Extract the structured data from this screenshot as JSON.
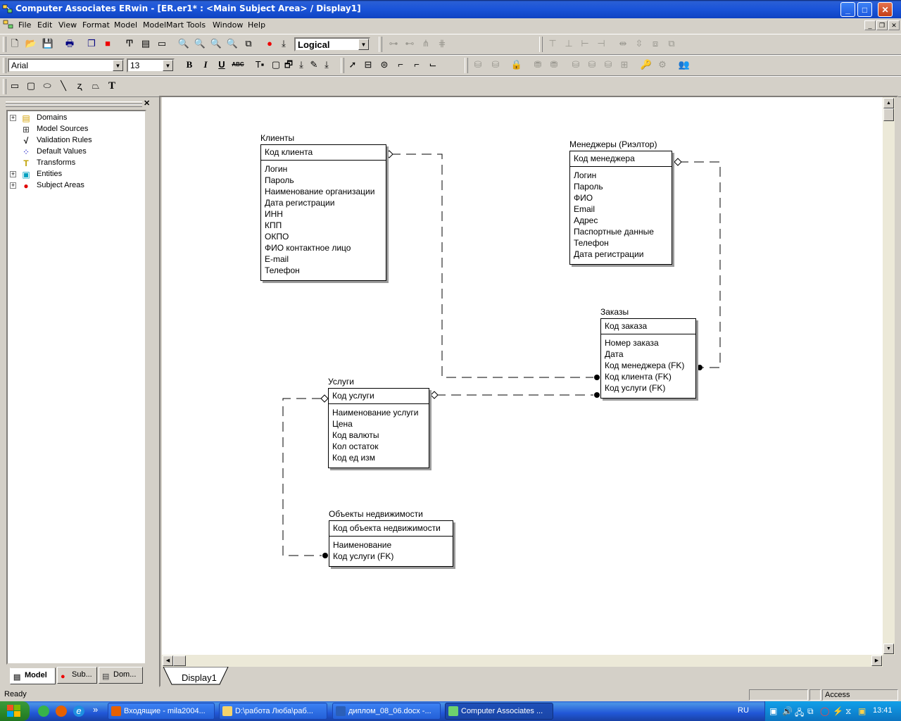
{
  "window": {
    "title": "Computer Associates ERwin - [ER.er1* : <Main Subject Area> / Display1]"
  },
  "menu": [
    "File",
    "Edit",
    "View",
    "Format",
    "Model",
    "ModelMart",
    "Tools",
    "Window",
    "Help"
  ],
  "toolbar": {
    "view_mode": "Logical",
    "font_name": "Arial",
    "font_size": "13",
    "bold": "B",
    "italic": "I",
    "underline": "U",
    "strike": "ABC",
    "text_tool": "T"
  },
  "tree": {
    "items": [
      {
        "label": "Domains",
        "expandable": true,
        "icon": "domains-icon"
      },
      {
        "label": "Model Sources",
        "expandable": false,
        "icon": "model-sources-icon"
      },
      {
        "label": "Validation Rules",
        "expandable": false,
        "icon": "validation-rules-icon"
      },
      {
        "label": "Default Values",
        "expandable": false,
        "icon": "default-values-icon"
      },
      {
        "label": "Transforms",
        "expandable": false,
        "icon": "transforms-icon"
      },
      {
        "label": "Entities",
        "expandable": true,
        "icon": "entities-icon"
      },
      {
        "label": "Subject Areas",
        "expandable": true,
        "icon": "subject-areas-icon"
      }
    ]
  },
  "panel_tabs": [
    "Model",
    "Sub...",
    "Dom..."
  ],
  "entities": {
    "clients": {
      "title": "Клиенты",
      "pk": "Код клиента",
      "attrs": [
        "Логин",
        "Пароль",
        "Наименование организации",
        "Дата регистрации",
        "ИНН",
        "КПП",
        "ОКПО",
        "ФИО контактное лицо",
        "E-mail",
        "Телефон"
      ]
    },
    "managers": {
      "title": "Менеджеры (Риэлтор)",
      "pk": "Код менеджера",
      "attrs": [
        "Логин",
        "Пароль",
        "ФИО",
        "Email",
        "Адрес",
        "Паспортные данные",
        "Телефон",
        "Дата регистрации"
      ]
    },
    "orders": {
      "title": "Заказы",
      "pk": "Код заказа",
      "attrs": [
        "Номер заказа",
        "Дата",
        "Код менеджера (FK)",
        "Код клиента (FK)",
        "Код услуги (FK)"
      ]
    },
    "services": {
      "title": "Услуги",
      "pk": "Код услуги",
      "attrs": [
        "Наименование услуги",
        "Цена",
        "Код валюты",
        "Кол остаток",
        "Код ед изм"
      ]
    },
    "properties": {
      "title": "Объекты недвижимости",
      "pk": "Код объекта недвижимости",
      "attrs": [
        "Наименование",
        "Код услуги (FK)"
      ]
    }
  },
  "display_tab": "Display1",
  "status": {
    "text": "Ready",
    "mode": "Access"
  },
  "taskbar": {
    "tasks": [
      "Входящие - mila2004...",
      "D:\\работа Люба\\раб...",
      "диплом_08_06.docx -...",
      "Computer Associates ..."
    ],
    "lang": "RU",
    "clock": "13:41",
    "quicklaunch_more": "»"
  }
}
